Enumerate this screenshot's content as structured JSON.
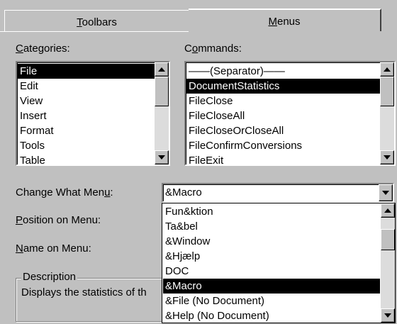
{
  "tabs": [
    {
      "label_pre": "",
      "label_u": "T",
      "label_post": "oolbars"
    },
    {
      "label_pre": "",
      "label_u": "M",
      "label_post": "enus"
    }
  ],
  "categories": {
    "label_pre": "",
    "label_u": "C",
    "label_post": "ategories:",
    "items": [
      "File",
      "Edit",
      "View",
      "Insert",
      "Format",
      "Tools",
      "Table"
    ],
    "selected_index": 0
  },
  "commands": {
    "label_pre": "C",
    "label_u": "o",
    "label_post": "mmands:",
    "items": [
      "——(Separator)——",
      "DocumentStatistics",
      "FileClose",
      "FileCloseAll",
      "FileCloseOrCloseAll",
      "FileConfirmConversions",
      "FileExit"
    ],
    "selected_index": 1
  },
  "change_menu": {
    "label_pre": "Change What Men",
    "label_u": "u",
    "label_post": ":",
    "value": "&Macro",
    "options": [
      "Fun&ktion",
      "Ta&bel",
      "&Window",
      "&Hjælp",
      "DOC",
      "&Macro",
      "&File (No Document)",
      "&Help (No Document)"
    ],
    "selected_index": 5
  },
  "position_label": {
    "pre": "",
    "u": "P",
    "post": "osition on Menu:"
  },
  "name_label": {
    "pre": "",
    "u": "N",
    "post": "ame on Menu:"
  },
  "description": {
    "title": "Description",
    "text": "Displays the statistics of th"
  }
}
